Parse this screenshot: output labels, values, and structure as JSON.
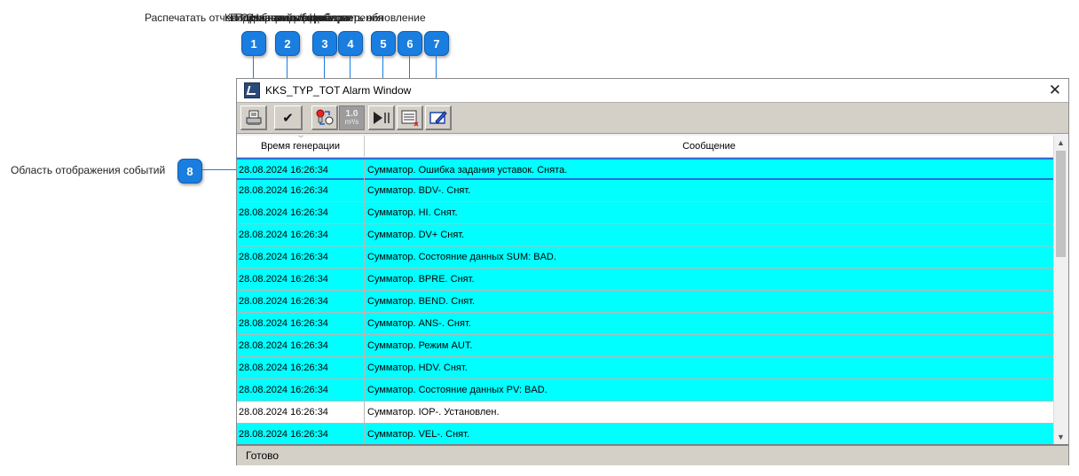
{
  "callouts": {
    "labels": [
      "Распечатать отчет",
      "Квитировать событие",
      "Подробная информация",
      "Показать единицы измерения",
      "Остановить/возобновить обновление",
      "Сохранить в файл",
      "Настройки фильтра"
    ],
    "numbers": [
      "1",
      "2",
      "3",
      "4",
      "5",
      "6",
      "7",
      "8"
    ],
    "events_area_label": "Область отображения событий"
  },
  "window": {
    "title": "KKS_TYP_TOT Alarm Window",
    "close_glyph": "✕"
  },
  "toolbar": {
    "print_icon": "printer-icon",
    "ack_glyph": "✔",
    "units_text": "1.0",
    "units_sub": "m³/s",
    "pause_glyph": "▶||"
  },
  "table": {
    "columns": [
      "Время генерации",
      "Сообщение"
    ],
    "rows": [
      {
        "time": "28.08.2024 16:26:34",
        "message": "Сумматор. Ошибка задания уставок. Снята.",
        "color": "#00ffff",
        "selected": true
      },
      {
        "time": "28.08.2024 16:26:34",
        "message": "Сумматор. BDV-. Снят.",
        "color": "#00ffff"
      },
      {
        "time": "28.08.2024 16:26:34",
        "message": "Сумматор. HI. Снят.",
        "color": "#00ffff"
      },
      {
        "time": "28.08.2024 16:26:34",
        "message": "Сумматор. DV+ Снят.",
        "color": "#00ffff"
      },
      {
        "time": "28.08.2024 16:26:34",
        "message": "Сумматор. Состояние данных SUM: BAD.",
        "color": "#00ffff"
      },
      {
        "time": "28.08.2024 16:26:34",
        "message": "Сумматор. BPRE. Снят.",
        "color": "#00ffff"
      },
      {
        "time": "28.08.2024 16:26:34",
        "message": "Сумматор. BEND. Снят.",
        "color": "#00ffff"
      },
      {
        "time": "28.08.2024 16:26:34",
        "message": "Сумматор. ANS-. Снят.",
        "color": "#00ffff"
      },
      {
        "time": "28.08.2024 16:26:34",
        "message": "Сумматор. Режим AUT.",
        "color": "#00ffff"
      },
      {
        "time": "28.08.2024 16:26:34",
        "message": "Сумматор. HDV. Снят.",
        "color": "#00ffff"
      },
      {
        "time": "28.08.2024 16:26:34",
        "message": "Сумматор. Состояние данных PV: BAD.",
        "color": "#00ffff"
      },
      {
        "time": "28.08.2024 16:26:34",
        "message": "Сумматор. IOP-. Установлен.",
        "color": "#ffffff"
      },
      {
        "time": "28.08.2024 16:26:34",
        "message": "Сумматор. VEL-. Снят.",
        "color": "#00ffff"
      }
    ]
  },
  "status": {
    "text": "Готово"
  },
  "colors": {
    "badge": "#1a7de0",
    "row_highlight": "#00ffff",
    "selection": "#2a6fd6"
  }
}
